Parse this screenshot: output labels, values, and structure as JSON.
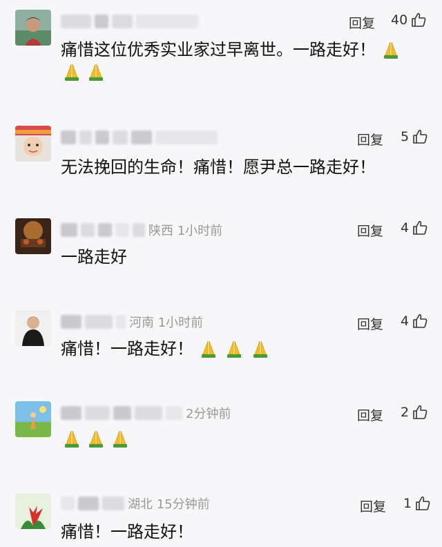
{
  "comments": [
    {
      "meta_suffix": "",
      "reply_label": "回复",
      "like_count": "40",
      "text": "痛惜这位优秀实业家过早离世。一路走好！",
      "trailing_emoji_count": 1,
      "second_line_emoji_count": 2
    },
    {
      "meta_suffix": "",
      "reply_label": "回复",
      "like_count": "5",
      "text": "无法挽回的生命！痛惜！愿尹总一路走好！",
      "trailing_emoji_count": 0,
      "second_line_emoji_count": 0
    },
    {
      "meta_suffix": "陕西 1小时前",
      "reply_label": "回复",
      "like_count": "4",
      "text": "一路走好",
      "trailing_emoji_count": 0,
      "second_line_emoji_count": 0
    },
    {
      "meta_suffix": "河南 1小时前",
      "reply_label": "回复",
      "like_count": "4",
      "text": "痛惜！一路走好！",
      "trailing_emoji_count": 3,
      "second_line_emoji_count": 0
    },
    {
      "meta_suffix": "2分钟前",
      "reply_label": "回复",
      "like_count": "2",
      "text": "",
      "trailing_emoji_count": 0,
      "second_line_emoji_count": 3
    },
    {
      "meta_suffix": "湖北 15分钟前",
      "reply_label": "回复",
      "like_count": "1",
      "text": "痛惜！一路走好！",
      "trailing_emoji_count": 0,
      "second_line_emoji_count": 0
    }
  ],
  "icons": {
    "like": "thumbs-up-icon",
    "emoji": "folded-hands-icon"
  },
  "colors": {
    "background": "#f7f7f9",
    "text_primary": "#111111",
    "text_meta": "#999999",
    "emoji_yellow": "#f4c020",
    "emoji_green": "#4a9a3c"
  }
}
